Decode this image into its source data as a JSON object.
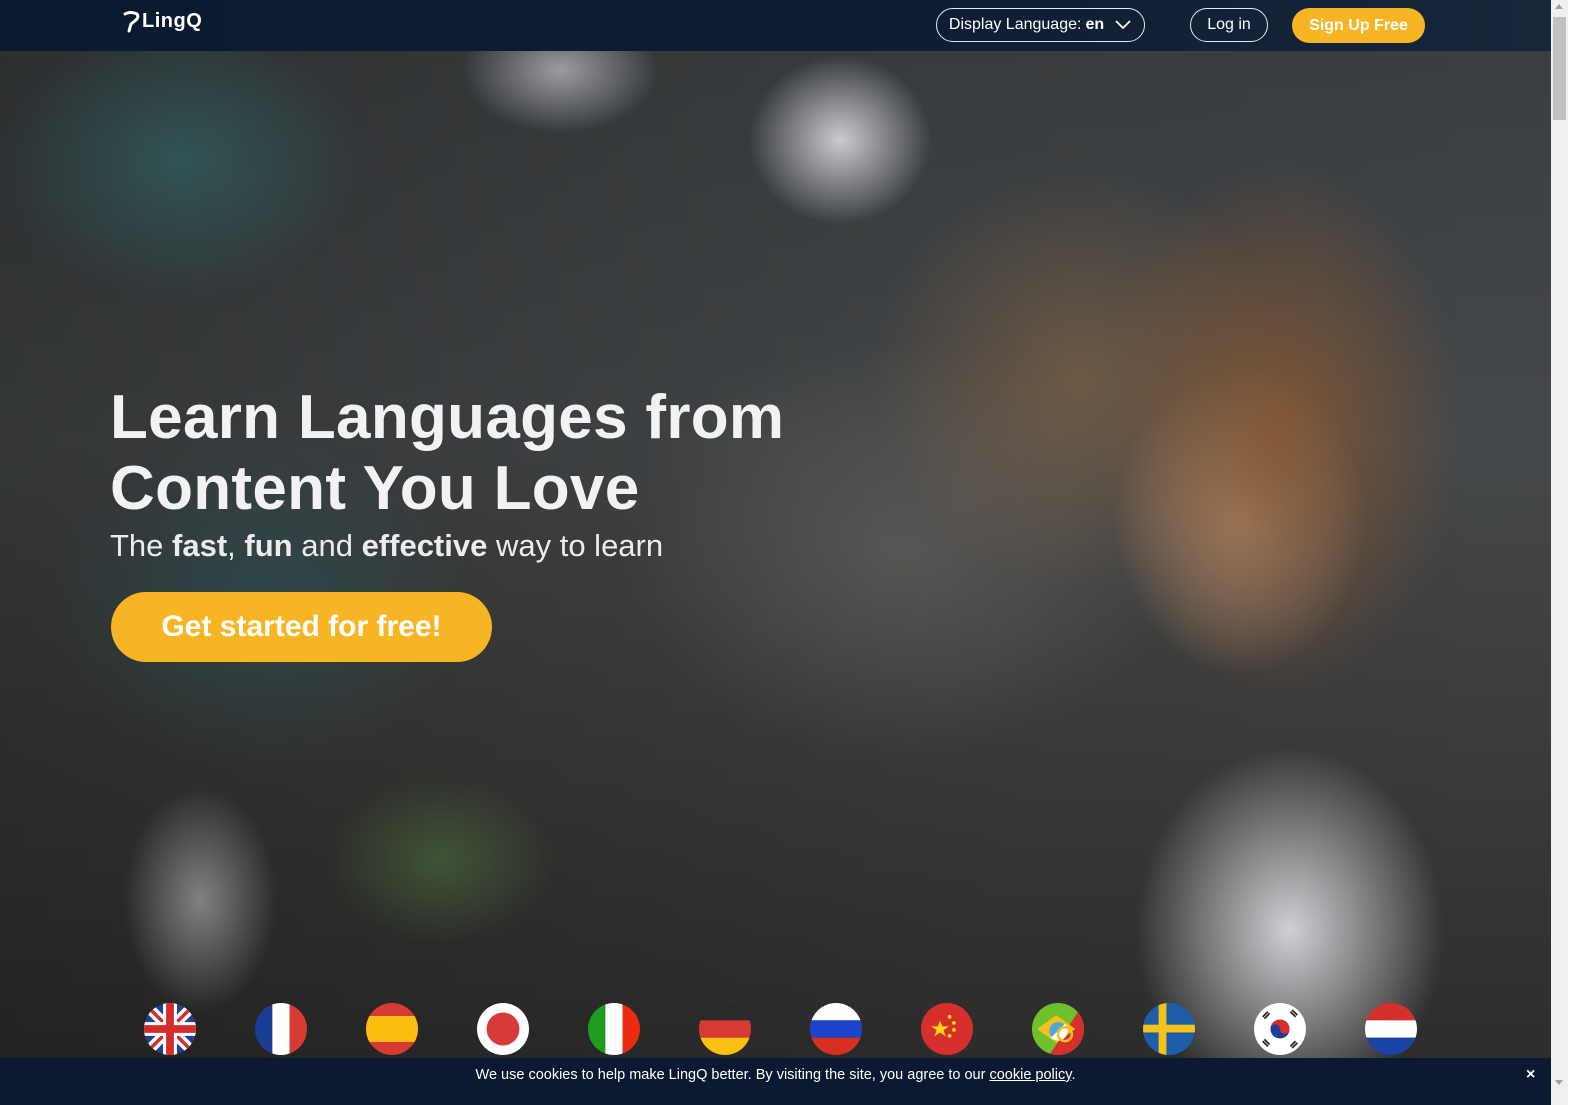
{
  "header": {
    "logo_text": "LingQ",
    "display_language_label": "Display Language: ",
    "display_language_value": "en",
    "login_label": "Log in",
    "signup_label": "Sign Up Free"
  },
  "hero": {
    "title_line1": "Learn Languages from",
    "title_line2": "Content You Love",
    "subtitle": {
      "part1": "The ",
      "bold1": "fast",
      "part2": ", ",
      "bold2": "fun",
      "part3": " and ",
      "bold3": "effective",
      "part4": " way to learn"
    },
    "cta_label": "Get started for free!"
  },
  "flags": [
    {
      "name": "uk-flag-icon",
      "language": "English"
    },
    {
      "name": "france-flag-icon",
      "language": "French"
    },
    {
      "name": "spain-flag-icon",
      "language": "Spanish"
    },
    {
      "name": "japan-flag-icon",
      "language": "Japanese"
    },
    {
      "name": "italy-flag-icon",
      "language": "Italian"
    },
    {
      "name": "germany-flag-icon",
      "language": "German"
    },
    {
      "name": "russia-flag-icon",
      "language": "Russian"
    },
    {
      "name": "china-flag-icon",
      "language": "Chinese"
    },
    {
      "name": "brazil-portugal-flag-icon",
      "language": "Portuguese"
    },
    {
      "name": "sweden-flag-icon",
      "language": "Swedish"
    },
    {
      "name": "korea-flag-icon",
      "language": "Korean"
    },
    {
      "name": "netherlands-flag-icon",
      "language": "Dutch"
    }
  ],
  "cookie_bar": {
    "text": "We use cookies to help make LingQ better. By visiting the site, you agree to our ",
    "link_label": "cookie policy",
    "suffix": ".",
    "close_label": "×"
  },
  "colors": {
    "accent": "#f7b523",
    "header_bg": "#0c1a30",
    "cookie_bg": "#0b1a30"
  }
}
